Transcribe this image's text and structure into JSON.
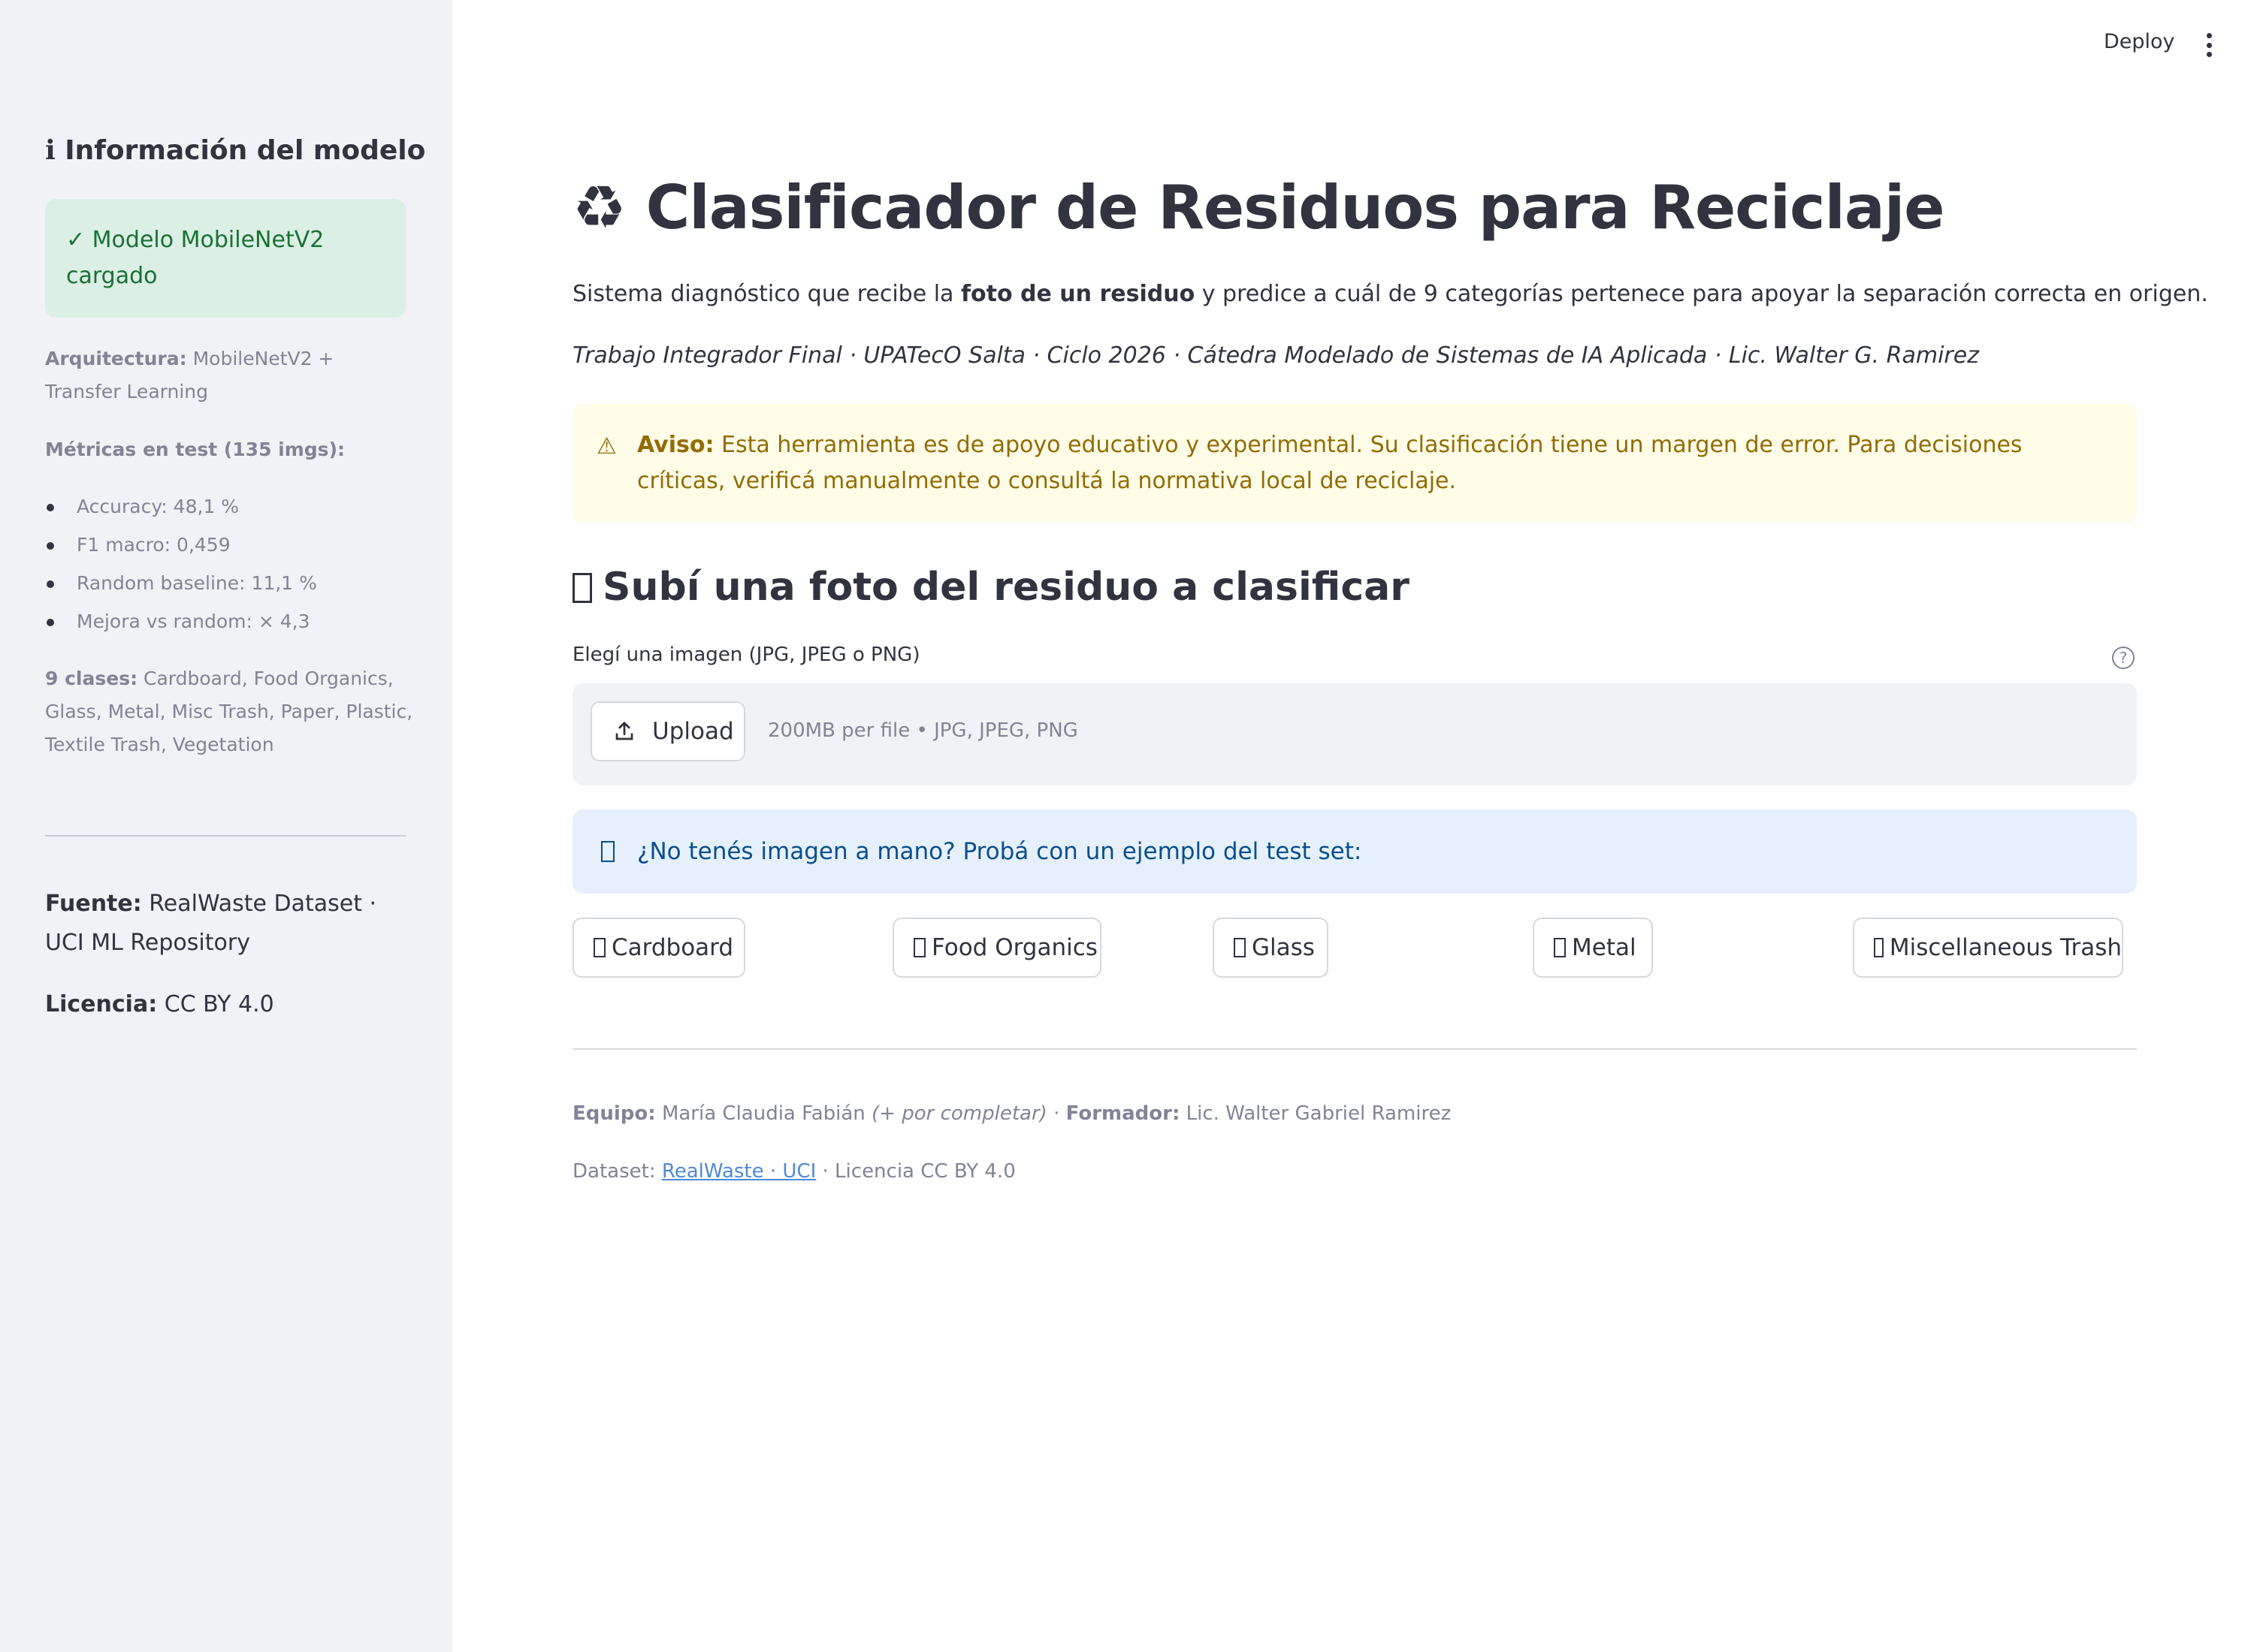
{
  "sidebar": {
    "title": "ℹ Información del modelo",
    "model_status": "✓ Modelo MobileNetV2 cargado",
    "architecture_label": "Arquitectura:",
    "architecture_value": "MobileNetV2 + Transfer Learning",
    "metrics_title": "Métricas en test (135 imgs):",
    "metrics": [
      "Accuracy: 48,1 %",
      "F1 macro: 0,459",
      "Random baseline: 11,1 %",
      "Mejora vs random: × 4,3"
    ],
    "classes_label": "9 clases:",
    "classes_value": "Cardboard, Food Organics, Glass, Metal, Misc Trash, Paper, Plastic, Textile Trash, Vegetation",
    "source_label": "Fuente:",
    "source_value": "RealWaste Dataset · UCI ML Repository",
    "license_label": "Licencia:",
    "license_value": "CC BY 4.0"
  },
  "header": {
    "deploy_label": "Deploy",
    "menu_icon": "vertical-dots-icon"
  },
  "main": {
    "title": "♻ Clasificador de Residuos para Reciclaje",
    "subtitle_pre": "Sistema diagnóstico que recibe la",
    "subtitle_bold": "foto de un residuo",
    "subtitle_post": "y predice a cuál de 9 categorías pertenece para apoyar la separación correcta en origen.",
    "credits": "Trabajo Integrador Final · UPATecO Salta · Ciclo 2026 · Cátedra Modelado de Sistemas de IA Aplicada · Lic. Walter G. Ramirez",
    "warning_icon": "⚠",
    "warning_label": "Aviso:",
    "warning_text": "Esta herramienta es de apoyo educativo y experimental. Su clasificación tiene un margen de error. Para decisiones críticas, verificá manualmente o consultá la normativa local de reciclaje.",
    "upload_heading": "Subí una foto del residuo a clasificar",
    "upload_label": "Elegí una imagen (JPG, JPEG o PNG)",
    "help_icon": "?",
    "upload_button": "Upload",
    "upload_hint": "200MB per file • JPG, JPEG, PNG",
    "info_text": "¿No tenés imagen a mano? Probá con un ejemplo del test set:",
    "examples": [
      "Cardboard",
      "Food Organics",
      "Glass",
      "Metal",
      "Miscellaneous Trash"
    ]
  },
  "footer": {
    "team_label": "Equipo:",
    "team_value": "María Claudia Fabián",
    "team_note": "(+ por completar)",
    "sep": "·",
    "trainer_label": "Formador:",
    "trainer_value": "Lic. Walter Gabriel Ramirez",
    "dataset_label": "Dataset:",
    "dataset_link": "RealWaste · UCI",
    "dataset_license": "· Licencia CC BY 4.0"
  },
  "colors": {
    "sidebar_bg": "#f0f2f6",
    "success_bg": "#dcefe5",
    "success_text": "#177233",
    "warning_bg": "#fffce7",
    "warning_text": "#926c05",
    "info_bg": "#e6f0fc",
    "info_text": "#0a4f8c",
    "text": "#31333f",
    "muted": "#808495"
  }
}
